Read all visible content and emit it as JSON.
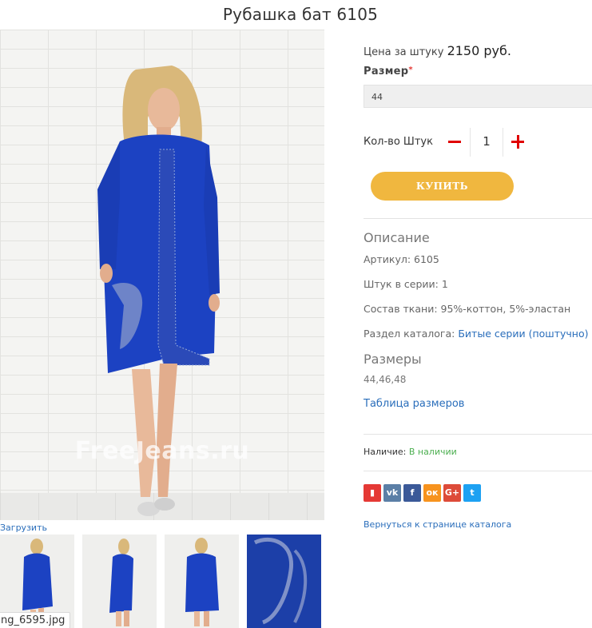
{
  "product": {
    "title": "Рубашка бат 6105",
    "watermark": "FreeJeans.ru",
    "upload_label": "Загрузить",
    "thumbnail_filename": "ng_6595.jpg"
  },
  "purchase": {
    "price_label": "Цена за штуку",
    "price_value": "2150 руб.",
    "size_label": "Размер",
    "size_required_mark": "*",
    "size_selected": "44",
    "qty_label": "Кол-во Штук",
    "qty_value": "1",
    "buy_label": "КУПИТЬ"
  },
  "description": {
    "title": "Описание",
    "article": "Артикул: 6105",
    "per_series": "Штук в серии: 1",
    "fabric": "Состав ткани: 95%-коттон, 5%-эластан",
    "catalog_prefix": "Раздел каталога:",
    "catalog_link": "Битые серии (поштучно)",
    "sizes_title": "Размеры",
    "sizes_values": "44,46,48",
    "size_table_link": "Таблица размеров"
  },
  "availability": {
    "label": "Наличие:",
    "value": "В наличии"
  },
  "share": [
    {
      "icon": "bookmark-icon",
      "glyph": "▮",
      "color": "#e53935"
    },
    {
      "icon": "vk-icon",
      "glyph": "vk",
      "color": "#5b7fa6"
    },
    {
      "icon": "facebook-icon",
      "glyph": "f",
      "color": "#3b5998"
    },
    {
      "icon": "odnoklassniki-icon",
      "glyph": "ок",
      "color": "#f7931e"
    },
    {
      "icon": "google-plus-icon",
      "glyph": "G+",
      "color": "#dd4b39"
    },
    {
      "icon": "twitter-icon",
      "glyph": "t",
      "color": "#1da1f2"
    }
  ],
  "back_link": "Вернуться к странице каталога",
  "colors": {
    "accent_link": "#2a6ebb",
    "buy_button": "#f0b73f",
    "qty_controls": "#e00000",
    "in_stock": "#4caf50"
  }
}
